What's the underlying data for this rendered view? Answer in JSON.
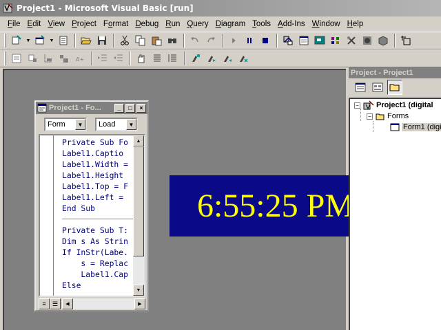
{
  "window": {
    "title": "Project1 - Microsoft Visual Basic [run]"
  },
  "menu": [
    "File",
    "Edit",
    "View",
    "Project",
    "Format",
    "Debug",
    "Run",
    "Query",
    "Diagram",
    "Tools",
    "Add-Ins",
    "Window",
    "Help"
  ],
  "menu_mnemonic_index": [
    0,
    0,
    0,
    0,
    1,
    0,
    0,
    0,
    0,
    0,
    0,
    0,
    0
  ],
  "toolbar1_icons": [
    "add-project-icon",
    "add-form-icon",
    "menu-editor-icon",
    "open-project-icon",
    "save-project-icon",
    "cut-icon",
    "copy-icon",
    "paste-icon",
    "find-icon",
    "undo-icon",
    "redo-icon",
    "start-icon",
    "break-icon",
    "end-icon",
    "project-explorer-icon",
    "properties-window-icon",
    "form-layout-icon",
    "object-browser-icon",
    "toolbox-icon",
    "data-view-icon",
    "component-manager-icon",
    "position-icon"
  ],
  "toolbar2_icons": [
    "indent-icon",
    "outdent-icon",
    "toggle-breakpoint-icon",
    "comment-block-icon",
    "uncomment-block-icon",
    "bookmark-icon",
    "next-bookmark-icon",
    "previous-bookmark-icon",
    "clear-bookmarks-icon",
    "list-properties-icon",
    "list-constants-icon",
    "quick-info-icon"
  ],
  "code_window": {
    "title": "Project1 - Fo...",
    "object_combo": "Form",
    "procedure_combo": "Load",
    "lines_block1": [
      "Private Sub Fo",
      "Label1.Captio",
      "Label1.Width =",
      "Label1.Height",
      "Label1.Top = F",
      "Label1.Left =",
      "End Sub"
    ],
    "lines_block2": [
      "Private Sub T:",
      "Dim s As Strin",
      "If InStr(Labe.",
      "    s = Replac",
      "    Label1.Cap",
      "Else"
    ]
  },
  "clock": {
    "time": "6:55:25 PM"
  },
  "project_explorer": {
    "title": "Project - Project1",
    "root": "Project1 (digital",
    "folder": "Forms",
    "form": "Form1 (digi"
  },
  "colors": {
    "clock_bg": "#0a0a88",
    "clock_text": "#ffff00",
    "code_text": "#000080",
    "workspace": "#808080"
  }
}
